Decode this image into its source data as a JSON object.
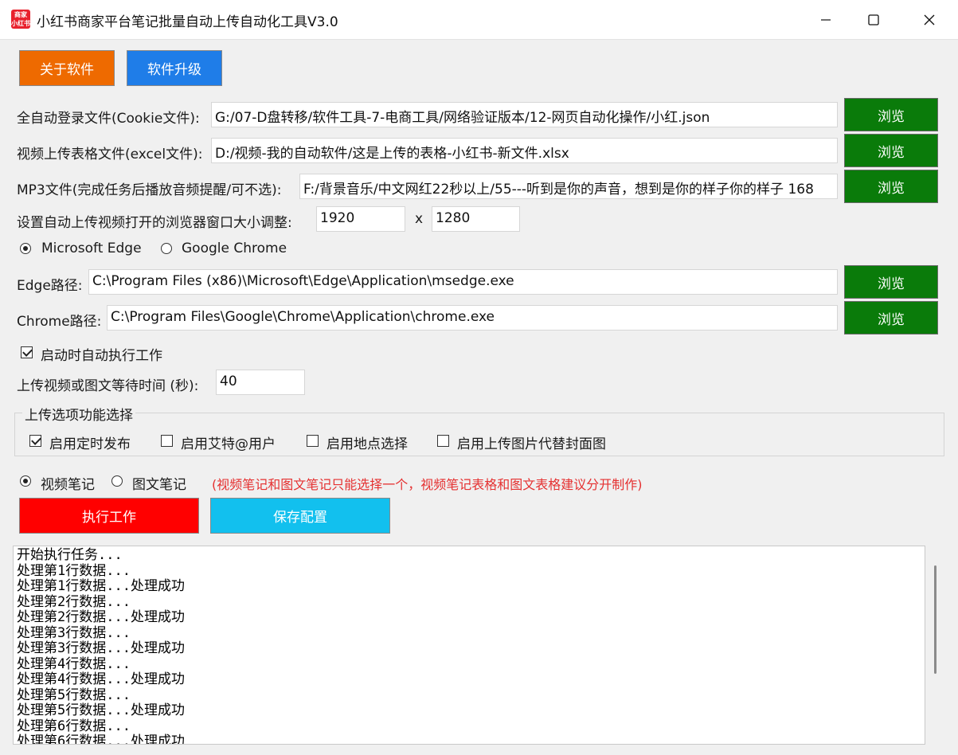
{
  "window": {
    "icon_top": "商家",
    "icon_bottom": "小红书",
    "title": "小红书商家平台笔记批量自动上传自动化工具V3.0"
  },
  "toolbar": {
    "about_label": "关于软件",
    "upgrade_label": "软件升级"
  },
  "files": {
    "cookie_label": "全自动登录文件(Cookie文件):",
    "cookie_value": "G:/07-D盘转移/软件工具-7-电商工具/网络验证版本/12-网页自动化操作/小红.json",
    "excel_label": "视频上传表格文件(excel文件):",
    "excel_value": "D:/视频-我的自动软件/这是上传的表格-小红书-新文件.xlsx",
    "mp3_label": "MP3文件(完成任务后播放音频提醒/可不选):",
    "mp3_value": "F:/背景音乐/中文网红22秒以上/55---听到是你的声音，想到是你的样子你的样子 168",
    "browse_label": "浏览"
  },
  "window_size": {
    "label": "设置自动上传视频打开的浏览器窗口大小调整:",
    "width": "1920",
    "separator": "x",
    "height": "1280"
  },
  "browser": {
    "edge_option": "Microsoft Edge",
    "chrome_option": "Google Chrome",
    "selected": "Microsoft Edge",
    "edge_path_label": "Edge路径:",
    "edge_path_value": "C:\\Program Files (x86)\\Microsoft\\Edge\\Application\\msedge.exe",
    "chrome_path_label": "Chrome路径:",
    "chrome_path_value": "C:\\Program Files\\Google\\Chrome\\Application\\chrome.exe"
  },
  "autostart": {
    "label": "启动时自动执行工作",
    "checked": true
  },
  "wait": {
    "label": "上传视频或图文等待时间 (秒):",
    "value": "40"
  },
  "upload_options": {
    "title": "上传选项功能选择",
    "items": [
      {
        "label": "启用定时发布",
        "checked": true
      },
      {
        "label": "启用艾特@用户",
        "checked": false
      },
      {
        "label": "启用地点选择",
        "checked": false
      },
      {
        "label": "启用上传图片代替封面图",
        "checked": false
      }
    ]
  },
  "note_type": {
    "video_option": "视频笔记",
    "image_option": "图文笔记",
    "selected": "视频笔记",
    "hint": "(视频笔记和图文笔记只能选择一个，视频笔记表格和图文表格建议分开制作)"
  },
  "actions": {
    "run_label": "执行工作",
    "save_label": "保存配置"
  },
  "log": {
    "lines": [
      "开始执行任务...",
      "处理第1行数据...",
      "处理第1行数据...处理成功",
      "处理第2行数据...",
      "处理第2行数据...处理成功",
      "处理第3行数据...",
      "处理第3行数据...处理成功",
      "处理第4行数据...",
      "处理第4行数据...处理成功",
      "处理第5行数据...",
      "处理第5行数据...处理成功",
      "处理第6行数据...",
      "处理第6行数据...处理成功"
    ]
  },
  "colors": {
    "about_button": "#ee6a00",
    "upgrade_button": "#1f7de8",
    "browse_button": "#0a7b0a",
    "run_button": "#ff0000",
    "save_button": "#12c0ee",
    "hint_text": "#e53030"
  }
}
